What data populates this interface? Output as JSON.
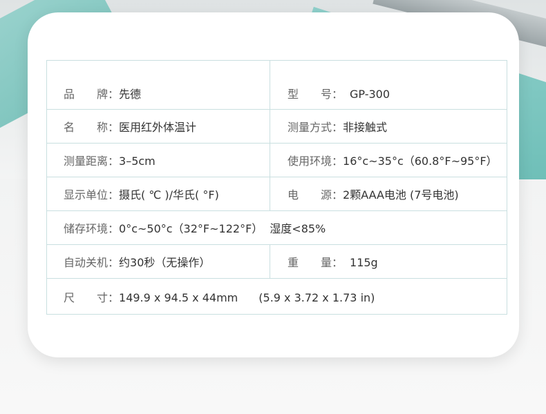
{
  "specs": {
    "brand": {
      "label": "品　　牌：",
      "value": "先德"
    },
    "model": {
      "label": "型　　号：",
      "value": "GP-300"
    },
    "name": {
      "label": "名　　称：",
      "value": "医用红外体温计"
    },
    "method": {
      "label": "测量方式：",
      "value": "非接触式"
    },
    "distance": {
      "label": "测量距离：",
      "value": "3–5cm"
    },
    "environment": {
      "label": "使用环境：",
      "value": "16°c~35°c（60.8°F~95°F）"
    },
    "unit": {
      "label": "显示单位：",
      "value": "摄氏( ℃ )/华氏( °F)"
    },
    "power": {
      "label": "电　　源：",
      "value": "2颗AAA电池 (7号电池)"
    },
    "storage": {
      "label": "储存环境：",
      "value": "0°c~50°c（32°F~122°F）",
      "extra": "湿度<85%"
    },
    "auto_off": {
      "label": "自动关机：",
      "value": "约30秒（无操作）"
    },
    "weight": {
      "label": "重　　量：",
      "value": "115g"
    },
    "size": {
      "label": "尺　　寸：",
      "value": "149.9 x 94.5 x 44mm",
      "extra": "(5.9 x 3.72 x 1.73 in)"
    }
  }
}
